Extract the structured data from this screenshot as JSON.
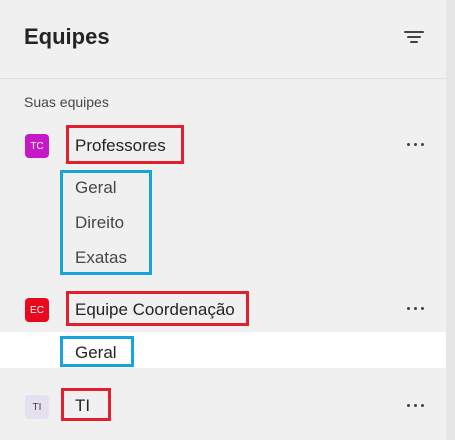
{
  "header": {
    "title": "Equipes",
    "filter_icon": "filter-lines-icon"
  },
  "section_label": "Suas equipes",
  "teams": [
    {
      "initials": "TC",
      "name": "Professores",
      "avatar_color": "#c618c6",
      "channels": [
        "Geral",
        "Direito",
        "Exatas"
      ]
    },
    {
      "initials": "EC",
      "name": "Equipe Coordenação",
      "avatar_color": "#e8091f",
      "channels": [
        "Geral"
      ],
      "selected_channel": "Geral"
    },
    {
      "initials": "TI",
      "name": "TI",
      "avatar_color": "#e4e0ef",
      "avatar_text_color": "#424242",
      "channels": []
    }
  ],
  "colors": {
    "highlight_red": "#e0202f",
    "highlight_blue": "#16a4da",
    "selected_background": "#ffffff"
  },
  "more_icon": "more-options-icon"
}
